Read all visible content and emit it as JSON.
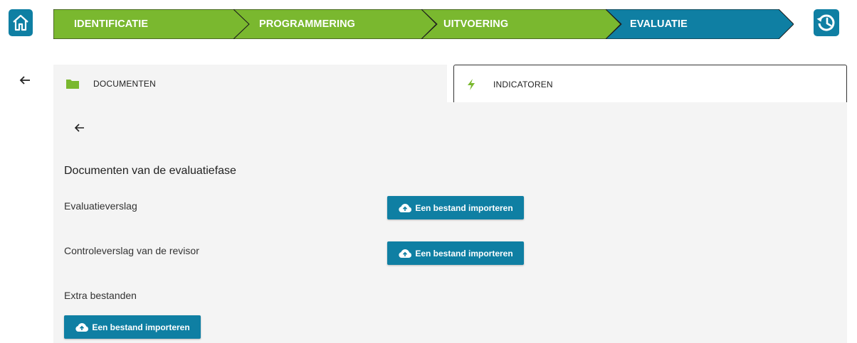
{
  "steps": [
    {
      "label": "IDENTIFICATIE",
      "color": "#7ab82f"
    },
    {
      "label": "PROGRAMMERING",
      "color": "#7ab82f"
    },
    {
      "label": "UITVOERING",
      "color": "#7ab82f"
    },
    {
      "label": "EVALUATIE",
      "color": "#0f7fa3"
    }
  ],
  "tabs": {
    "documents": "DOCUMENTEN",
    "indicators": "INDICATOREN"
  },
  "section": {
    "title": "Documenten van de evaluatiefase",
    "rows": [
      {
        "label": "Evaluatieverslag",
        "button": "Een bestand importeren"
      },
      {
        "label": "Controleverslag van de revisor",
        "button": "Een bestand importeren"
      },
      {
        "label": "Extra bestanden",
        "button": "Een bestand importeren"
      }
    ]
  },
  "colors": {
    "accent": "#0f7fa3",
    "green": "#7ab82f",
    "panel": "#f4f4f4"
  }
}
